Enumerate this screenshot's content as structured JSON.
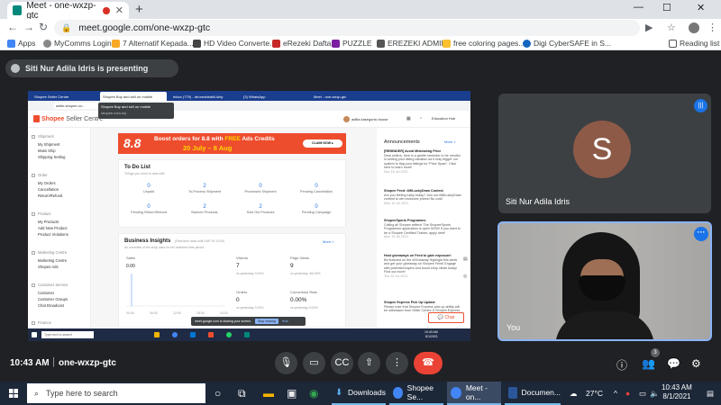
{
  "browser": {
    "tab_title": "Meet - one-wxzp-gtc",
    "url": "meet.google.com/one-wxzp-gtc"
  },
  "bookmarks": [
    "Apps",
    "MyComms Login",
    "7 Alternatif Kepada...",
    "HD Video Converte...",
    "eRezeki Daftar",
    "PUZZLE",
    "EREZEKI ADMIN",
    "free coloring pages...",
    "Digi CyberSAFE in S...",
    "Reading list"
  ],
  "meet": {
    "presenting_text": "Siti Nur Adila Idris is presenting",
    "time": "10:43 AM",
    "separator": "|",
    "meeting_code": "one-wxzp-gtc",
    "participant_count": "3",
    "participants": [
      {
        "name": "Siti Nur Adila Idris",
        "initial": "S"
      },
      {
        "name": "You"
      }
    ]
  },
  "shared_screen": {
    "tabs": [
      "Shopee Seller Centre",
      "Shopee Buy and sell on mobile",
      "Inbox (779) - drrumahbahil.kbiy",
      "(3) WhatsApp",
      "Meet - one-wxzp-gtc"
    ],
    "url": "seller.shopee.co...",
    "tooltip_title": "Shopee Buy and sell on mobile",
    "tooltip_sub": "shopee.com.my",
    "logo": "Shopee",
    "logo_sub": "Seller Centre",
    "user": "adilla kasegonic.house",
    "edu": "Education Hub",
    "sidebar": [
      {
        "section": "Shipment",
        "items": [
          "My Shipment",
          "Mass Ship",
          "Shipping Setting"
        ]
      },
      {
        "section": "Order",
        "items": [
          "My Orders",
          "Cancellation",
          "Return/Refund"
        ]
      },
      {
        "section": "Product",
        "items": [
          "My Products",
          "Add New Product",
          "Product Violations"
        ]
      },
      {
        "section": "Marketing Centre",
        "items": [
          "Marketing Centre",
          "Shopee Ads"
        ]
      },
      {
        "section": "Customer Service",
        "items": [
          "Customer",
          "Customer Groups",
          "Chat Broadcast"
        ]
      },
      {
        "section": "Finance",
        "items": []
      }
    ],
    "banner": {
      "big": "8.8",
      "line1_pre": "Boost orders for 8.8 with",
      "line1_free": "FREE",
      "line1_post": "Ads Credits",
      "line2": "20 July – 8 Aug",
      "cta": "CLAIM NOW ▸"
    },
    "todo": {
      "title": "To Do List",
      "subtitle": "Things you need to deal with",
      "cells": [
        {
          "num": "0",
          "label": "Unpaid"
        },
        {
          "num": "2",
          "label": "To-Process Shipment"
        },
        {
          "num": "0",
          "label": "Processed Shipment"
        },
        {
          "num": "0",
          "label": "Pending Cancellation"
        },
        {
          "num": "0",
          "label": "Pending Return/Refund"
        },
        {
          "num": "2",
          "label": "Banned Products"
        },
        {
          "num": "2",
          "label": "Sold Out Products"
        },
        {
          "num": "0",
          "label": "Pending Campaign"
        }
      ]
    },
    "insights": {
      "title": "Business Insights",
      "meta": "(Real-time data until GMT+8 10:00)",
      "subtitle": "An overview of the shop data for the selected time period",
      "more": "More >",
      "sales_label": "Sales",
      "sales_value": "0.00",
      "visitors_label": "Visitors",
      "visitors_value": "7",
      "visitors_cmp": "vs yesterday 0.00%",
      "pageviews_label": "Page Views",
      "pageviews_value": "9",
      "pageviews_cmp": "vs yesterday -80.00%",
      "orders_label": "Orders",
      "orders_value": "0",
      "orders_cmp": "vs yesterday 0.00%",
      "conv_label": "Conversion Rate",
      "conv_value": "0.00%",
      "conv_cmp": "vs yesterday 0.00%",
      "x_ticks": [
        "00:00",
        "06:00",
        "12:00",
        "18:00",
        "24:00"
      ]
    },
    "announcements": {
      "title": "Announcements",
      "more": "More >",
      "items": [
        {
          "head": "[REMINDER] Avoid Misleading Price",
          "body": "Dear sellers, here is a gentle reminder to be mindful in setting your listing variation as it may trigger our system to flag your listings for 'Price Spam'. Click here to learn more!",
          "date": "Nov 18 Jul 2021"
        },
        {
          "head": "Shopee Feed: #MILuckyDraw Contest",
          "body": "Are you feeling lucky today? Join our #88LuckyDraw contest to win exclusive prizes! No cost!",
          "date": "Mon 19 Jul 2021"
        },
        {
          "head": "ShopeeSports Programme",
          "body": "Calling all Shopee sellers! The ShopeeSports Programme application is open NOW! If you want to be a Shopee Certified Trainer, apply here!",
          "date": "Mon 19 Jul 2021"
        },
        {
          "head": "Host giveaways on Feed to gain exposure!",
          "body": "Be featured on the #Giveaway Highlight this week and get your giveaway on Shopee Feed! Engage with potential buyers and boost shop views today! Find out more!",
          "date": "Thu 30 Jul 2021"
        },
        {
          "head": "Shopee Express Pick Up Update",
          "body": "Please note that Shopee Express pick up ability will be withdrawn from Seller Centre & Shopee Express",
          "date": ""
        }
      ]
    },
    "chat": "Chat",
    "sharebar_text": "meet.google.com is sharing your screen.",
    "sharebar_stop": "Stop sharing",
    "sharebar_hide": "Hide",
    "taskbar_search": "Type here to search",
    "taskbar_time": "10:43 AM",
    "taskbar_date": "8/1/2021"
  },
  "taskbar": {
    "search_placeholder": "Type here to search",
    "apps": [
      "Downloads",
      "Shopee Se...",
      "Meet - on...",
      "Documen..."
    ],
    "temperature": "27°C",
    "time": "10:43 AM",
    "date": "8/1/2021"
  }
}
